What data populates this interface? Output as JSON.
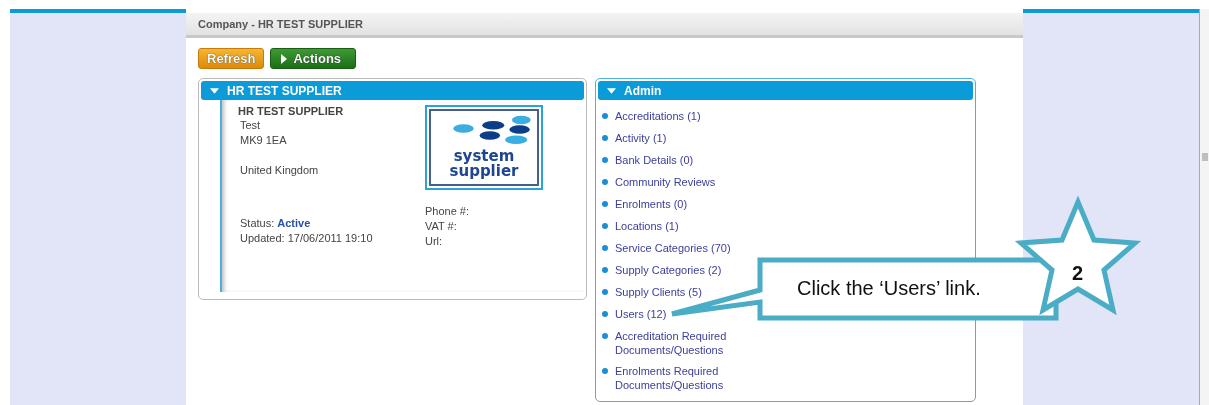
{
  "header": {
    "title": "Company - HR TEST SUPPLIER"
  },
  "buttons": [
    {
      "label": "Refresh",
      "kind": "orange"
    },
    {
      "label": "Actions",
      "kind": "green"
    }
  ],
  "company_panel": {
    "title": "HR TEST SUPPLIER",
    "expanded": true,
    "name": "HR TEST SUPPLIER",
    "address_lines": [
      "Test",
      "MK9 1EA"
    ],
    "country": "United Kingdom",
    "status_label": "Status:",
    "status": "Active",
    "updated": "Updated: 17/06/2011 19:10",
    "contact_labels": [
      "Phone #:",
      "VAT #:",
      "Url:"
    ],
    "logo": {
      "line_1": "system",
      "line_2": "supplier"
    }
  },
  "admin_panel": {
    "title": "Admin",
    "expanded": true,
    "links": [
      {
        "label": "Accreditations (1)"
      },
      {
        "label": "Activity (1)"
      },
      {
        "label": "Bank Details (0)"
      },
      {
        "label": "Community Reviews"
      },
      {
        "label": "Enrolments (0)"
      },
      {
        "label": "Locations (1)"
      },
      {
        "label": "Service Categories (70)"
      },
      {
        "label": "Supply Categories (2)"
      },
      {
        "label": "Supply Clients (5)"
      },
      {
        "label": "Users (12)"
      },
      {
        "label": "Accreditation Required Documents/Questions"
      },
      {
        "label": "Enrolments Required Documents/Questions"
      }
    ]
  },
  "callout": {
    "text": "Click the ‘Users’ link.",
    "step": "2"
  }
}
